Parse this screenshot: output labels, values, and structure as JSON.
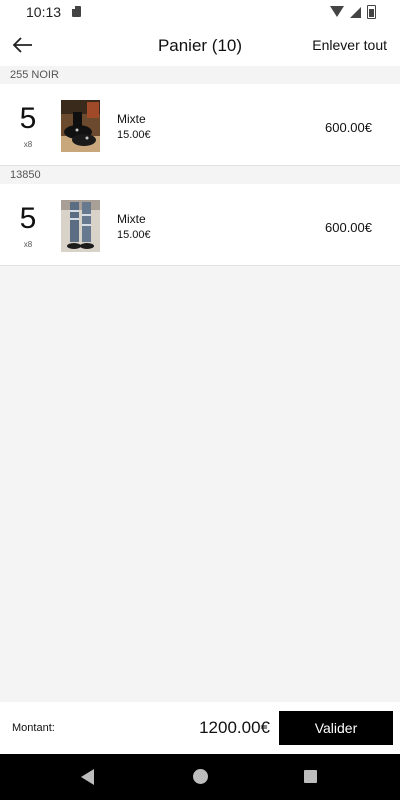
{
  "status_bar": {
    "time": "10:13",
    "icons": [
      "sd-card-icon",
      "wifi-icon",
      "signal-icon",
      "battery-icon"
    ]
  },
  "app_bar": {
    "title": "Panier (10)",
    "back_icon": "arrow-left-icon",
    "remove_all_label": "Enlever tout"
  },
  "cart": {
    "groups": [
      {
        "header": "255 NOIR",
        "item": {
          "quantity": "5",
          "pack": "x8",
          "image_icon": "shoe-photo",
          "name": "Mixte",
          "unit_price": "15.00€",
          "total": "600.00€"
        }
      },
      {
        "header": "13850",
        "item": {
          "quantity": "5",
          "pack": "x8",
          "image_icon": "jeans-photo",
          "name": "Mixte",
          "unit_price": "15.00€",
          "total": "600.00€"
        }
      }
    ]
  },
  "footer": {
    "amount_label": "Montant:",
    "amount_value": "1200.00€",
    "validate_label": "Valider"
  },
  "nav_bar": {
    "icons": [
      "nav-back-icon",
      "nav-home-icon",
      "nav-recents-icon"
    ]
  },
  "colors": {
    "background": "#f4f4f4",
    "surface": "#ffffff",
    "primary_button": "#000000",
    "nav_bar": "#000000"
  }
}
